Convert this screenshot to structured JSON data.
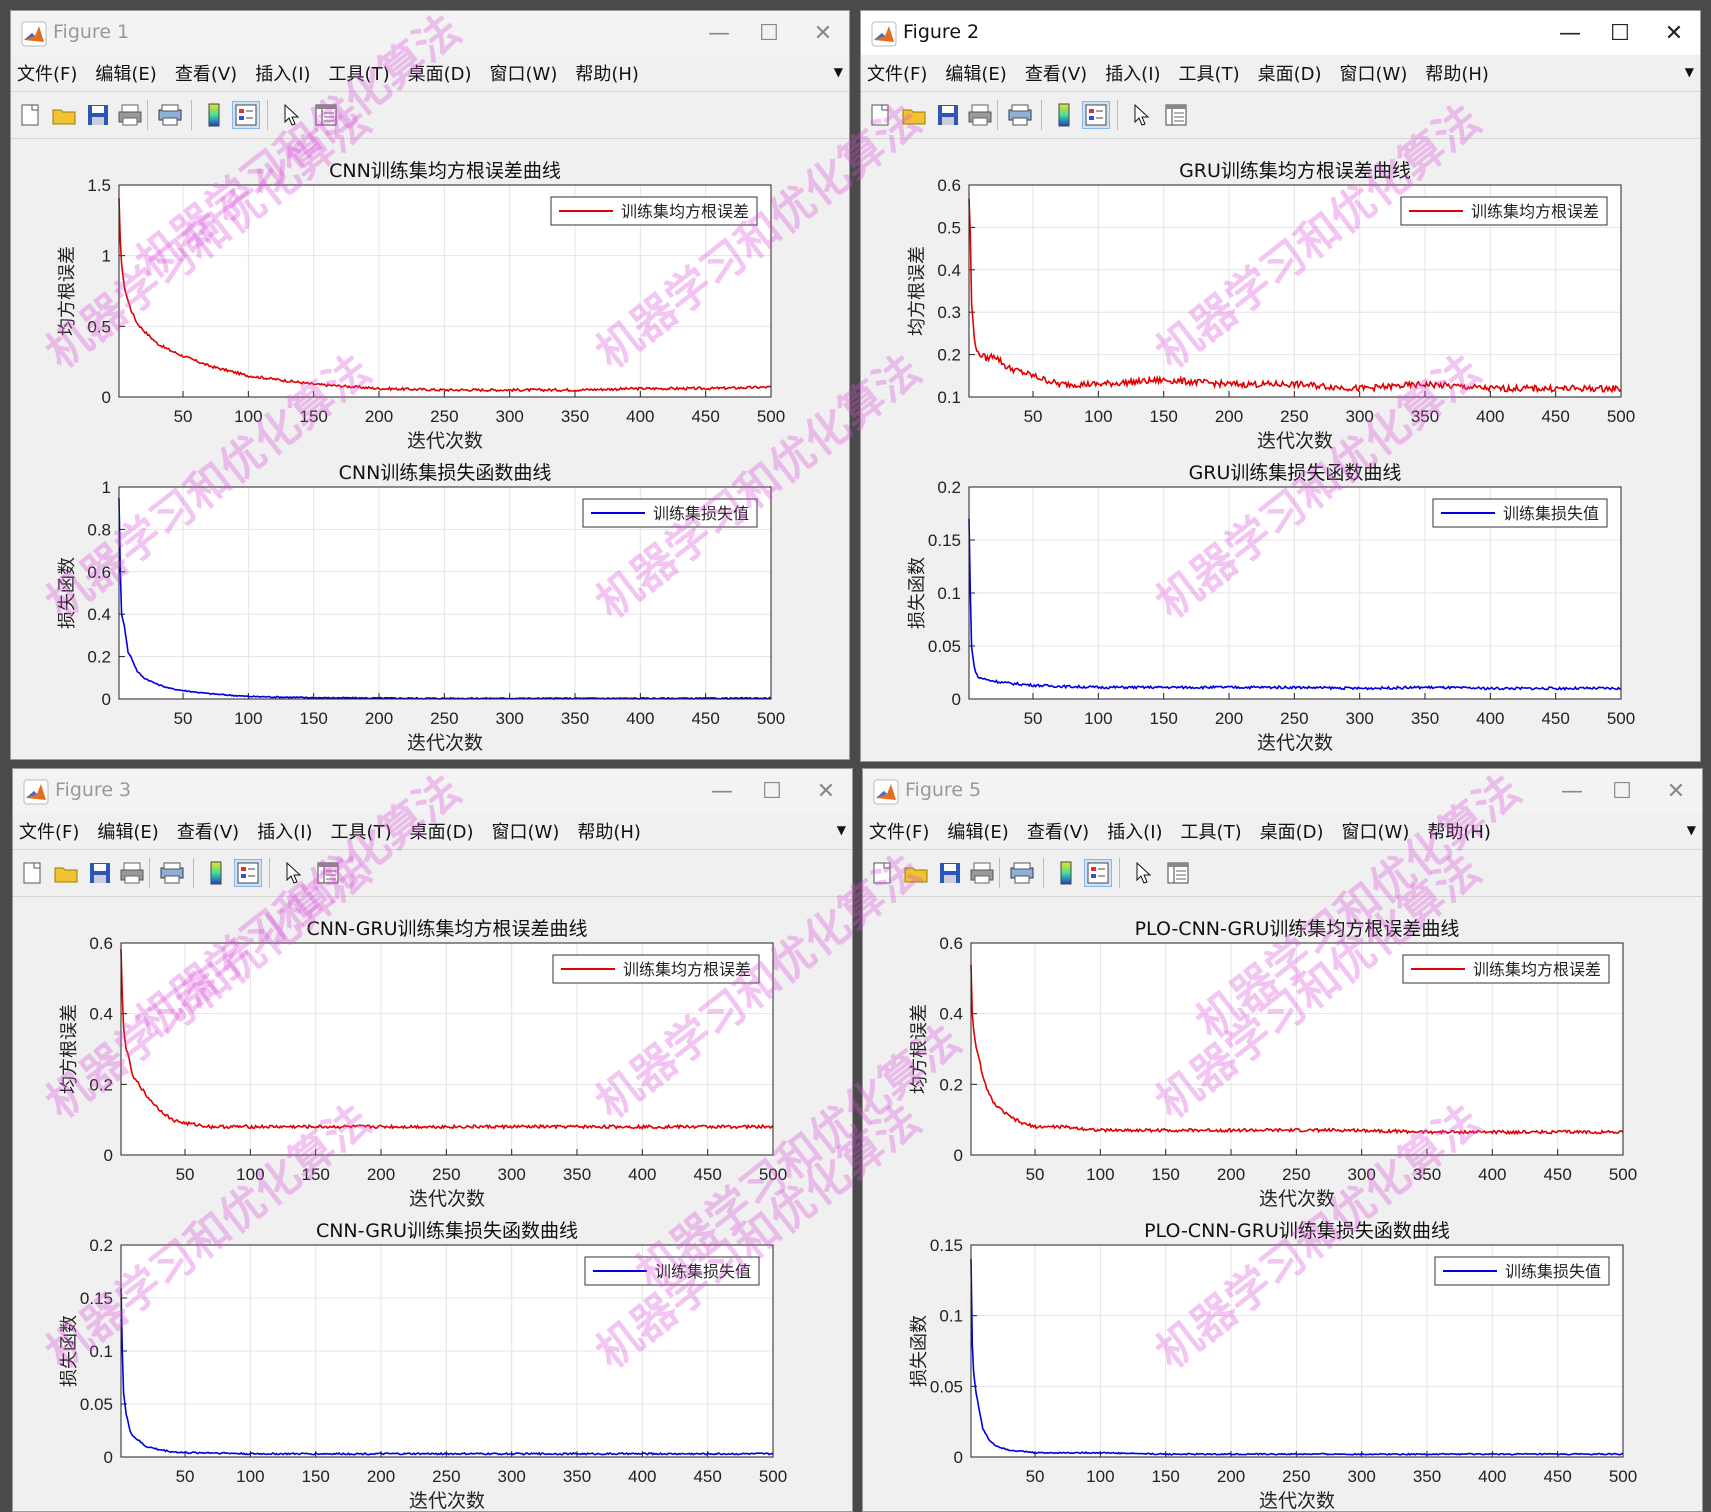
{
  "menu": [
    "文件(F)",
    "编辑(E)",
    "查看(V)",
    "插入(I)",
    "工具(T)",
    "桌面(D)",
    "窗口(W)",
    "帮助(H)"
  ],
  "toolbar_icons": [
    "new-figure-icon",
    "open-file-icon",
    "save-icon",
    "print-icon",
    "print-preview-icon",
    "colorbar-icon",
    "legend-icon",
    "pointer-icon",
    "property-inspector-icon"
  ],
  "windows": [
    {
      "title": "Figure 1",
      "active": false,
      "plots": [
        {
          "title": "CNN训练集均方根误差曲线",
          "xlabel": "迭代次数",
          "ylabel": "均方根误差",
          "legend": "训练集均方根误差",
          "color": "#e00000",
          "xlim": [
            1,
            500
          ],
          "ylim": [
            0,
            1.5
          ],
          "xticks": [
            "50",
            "100",
            "150",
            "200",
            "250",
            "300",
            "350",
            "400",
            "450",
            "500"
          ],
          "yticks": [
            "0",
            "0.5",
            "1",
            "1.5"
          ]
        },
        {
          "title": "CNN训练集损失函数曲线",
          "xlabel": "迭代次数",
          "ylabel": "损失函数",
          "legend": "训练集损失值",
          "color": "#0000e0",
          "xlim": [
            1,
            500
          ],
          "ylim": [
            0,
            1
          ],
          "xticks": [
            "50",
            "100",
            "150",
            "200",
            "250",
            "300",
            "350",
            "400",
            "450",
            "500"
          ],
          "yticks": [
            "0",
            "0.2",
            "0.4",
            "0.6",
            "0.8",
            "1"
          ]
        }
      ]
    },
    {
      "title": "Figure 2",
      "active": true,
      "plots": [
        {
          "title": "GRU训练集均方根误差曲线",
          "xlabel": "迭代次数",
          "ylabel": "均方根误差",
          "legend": "训练集均方根误差",
          "color": "#e00000",
          "xlim": [
            1,
            500
          ],
          "ylim": [
            0.1,
            0.6
          ],
          "xticks": [
            "50",
            "100",
            "150",
            "200",
            "250",
            "300",
            "350",
            "400",
            "450",
            "500"
          ],
          "yticks": [
            "0.1",
            "0.2",
            "0.3",
            "0.4",
            "0.5",
            "0.6"
          ]
        },
        {
          "title": "GRU训练集损失函数曲线",
          "xlabel": "迭代次数",
          "ylabel": "损失函数",
          "legend": "训练集损失值",
          "color": "#0000e0",
          "xlim": [
            1,
            500
          ],
          "ylim": [
            0,
            0.2
          ],
          "xticks": [
            "50",
            "100",
            "150",
            "200",
            "250",
            "300",
            "350",
            "400",
            "450",
            "500"
          ],
          "yticks": [
            "0",
            "0.05",
            "0.1",
            "0.15",
            "0.2"
          ]
        }
      ]
    },
    {
      "title": "Figure 3",
      "active": false,
      "plots": [
        {
          "title": "CNN-GRU训练集均方根误差曲线",
          "xlabel": "迭代次数",
          "ylabel": "均方根误差",
          "legend": "训练集均方根误差",
          "color": "#e00000",
          "xlim": [
            1,
            500
          ],
          "ylim": [
            0,
            0.6
          ],
          "xticks": [
            "50",
            "100",
            "150",
            "200",
            "250",
            "300",
            "350",
            "400",
            "450",
            "500"
          ],
          "yticks": [
            "0",
            "0.2",
            "0.4",
            "0.6"
          ]
        },
        {
          "title": "CNN-GRU训练集损失函数曲线",
          "xlabel": "迭代次数",
          "ylabel": "损失函数",
          "legend": "训练集损失值",
          "color": "#0000e0",
          "xlim": [
            1,
            500
          ],
          "ylim": [
            0,
            0.2
          ],
          "xticks": [
            "50",
            "100",
            "150",
            "200",
            "250",
            "300",
            "350",
            "400",
            "450",
            "500"
          ],
          "yticks": [
            "0",
            "0.05",
            "0.1",
            "0.15",
            "0.2"
          ]
        }
      ]
    },
    {
      "title": "Figure 5",
      "active": false,
      "plots": [
        {
          "title": "PLO-CNN-GRU训练集均方根误差曲线",
          "xlabel": "迭代次数",
          "ylabel": "均方根误差",
          "legend": "训练集均方根误差",
          "color": "#e00000",
          "xlim": [
            1,
            500
          ],
          "ylim": [
            0,
            0.6
          ],
          "xticks": [
            "50",
            "100",
            "150",
            "200",
            "250",
            "300",
            "350",
            "400",
            "450",
            "500"
          ],
          "yticks": [
            "0",
            "0.2",
            "0.4",
            "0.6"
          ]
        },
        {
          "title": "PLO-CNN-GRU训练集损失函数曲线",
          "xlabel": "迭代次数",
          "ylabel": "损失函数",
          "legend": "训练集损失值",
          "color": "#0000e0",
          "xlim": [
            1,
            500
          ],
          "ylim": [
            0,
            0.15
          ],
          "xticks": [
            "50",
            "100",
            "150",
            "200",
            "250",
            "300",
            "350",
            "400",
            "450",
            "500"
          ],
          "yticks": [
            "0",
            "0.05",
            "0.1",
            "0.15"
          ]
        }
      ]
    }
  ],
  "chart_data": [
    {
      "type": "line",
      "title": "CNN训练集均方根误差曲线",
      "xlabel": "迭代次数",
      "ylabel": "均方根误差",
      "xlim": [
        1,
        500
      ],
      "ylim": [
        0,
        1.5
      ],
      "grid": true,
      "legend": "top-right",
      "series": [
        {
          "name": "训练集均方根误差",
          "x": [
            1,
            2,
            3,
            5,
            8,
            10,
            15,
            20,
            30,
            40,
            50,
            70,
            100,
            150,
            200,
            250,
            300,
            350,
            400,
            450,
            500
          ],
          "y": [
            1.4,
            1.1,
            0.95,
            0.78,
            0.68,
            0.62,
            0.52,
            0.47,
            0.38,
            0.33,
            0.29,
            0.22,
            0.15,
            0.09,
            0.06,
            0.05,
            0.05,
            0.05,
            0.06,
            0.06,
            0.07
          ]
        }
      ]
    },
    {
      "type": "line",
      "title": "CNN训练集损失函数曲线",
      "xlabel": "迭代次数",
      "ylabel": "损失函数",
      "xlim": [
        1,
        500
      ],
      "ylim": [
        0,
        1
      ],
      "grid": true,
      "legend": "top-right",
      "series": [
        {
          "name": "训练集损失值",
          "x": [
            1,
            2,
            3,
            5,
            8,
            10,
            15,
            20,
            30,
            40,
            50,
            70,
            100,
            150,
            200,
            250,
            300,
            350,
            400,
            450,
            500
          ],
          "y": [
            0.95,
            0.6,
            0.4,
            0.35,
            0.22,
            0.2,
            0.13,
            0.1,
            0.07,
            0.05,
            0.04,
            0.025,
            0.012,
            0.006,
            0.004,
            0.003,
            0.003,
            0.003,
            0.003,
            0.003,
            0.004
          ]
        }
      ]
    },
    {
      "type": "line",
      "title": "GRU训练集均方根误差曲线",
      "xlabel": "迭代次数",
      "ylabel": "均方根误差",
      "xlim": [
        1,
        500
      ],
      "ylim": [
        0.1,
        0.6
      ],
      "grid": true,
      "legend": "top-right",
      "series": [
        {
          "name": "训练集均方根误差",
          "x": [
            1,
            2,
            3,
            5,
            8,
            10,
            15,
            20,
            30,
            40,
            50,
            70,
            100,
            150,
            200,
            250,
            300,
            350,
            400,
            450,
            500
          ],
          "y": [
            0.57,
            0.48,
            0.32,
            0.24,
            0.2,
            0.2,
            0.19,
            0.2,
            0.17,
            0.16,
            0.15,
            0.13,
            0.13,
            0.14,
            0.13,
            0.13,
            0.12,
            0.13,
            0.12,
            0.12,
            0.12
          ]
        }
      ]
    },
    {
      "type": "line",
      "title": "GRU训练集损失函数曲线",
      "xlabel": "迭代次数",
      "ylabel": "损失函数",
      "xlim": [
        1,
        500
      ],
      "ylim": [
        0,
        0.2
      ],
      "grid": true,
      "legend": "top-right",
      "series": [
        {
          "name": "训练集损失值",
          "x": [
            1,
            2,
            3,
            5,
            8,
            10,
            15,
            20,
            30,
            40,
            50,
            70,
            100,
            150,
            200,
            250,
            300,
            350,
            400,
            450,
            500
          ],
          "y": [
            0.17,
            0.1,
            0.05,
            0.03,
            0.02,
            0.02,
            0.018,
            0.017,
            0.015,
            0.014,
            0.013,
            0.012,
            0.011,
            0.011,
            0.011,
            0.011,
            0.01,
            0.011,
            0.01,
            0.01,
            0.01
          ]
        }
      ]
    },
    {
      "type": "line",
      "title": "CNN-GRU训练集均方根误差曲线",
      "xlabel": "迭代次数",
      "ylabel": "均方根误差",
      "xlim": [
        1,
        500
      ],
      "ylim": [
        0,
        0.6
      ],
      "grid": true,
      "legend": "top-right",
      "series": [
        {
          "name": "训练集均方根误差",
          "x": [
            1,
            2,
            3,
            5,
            8,
            10,
            15,
            20,
            30,
            40,
            50,
            70,
            100,
            150,
            200,
            250,
            300,
            350,
            400,
            450,
            500
          ],
          "y": [
            0.58,
            0.45,
            0.36,
            0.3,
            0.26,
            0.22,
            0.2,
            0.17,
            0.13,
            0.1,
            0.09,
            0.08,
            0.08,
            0.08,
            0.08,
            0.08,
            0.08,
            0.08,
            0.08,
            0.08,
            0.08
          ]
        }
      ]
    },
    {
      "type": "line",
      "title": "CNN-GRU训练集损失函数曲线",
      "xlabel": "迭代次数",
      "ylabel": "损失函数",
      "xlim": [
        1,
        500
      ],
      "ylim": [
        0,
        0.2
      ],
      "grid": true,
      "legend": "top-right",
      "series": [
        {
          "name": "训练集损失值",
          "x": [
            1,
            2,
            3,
            5,
            8,
            10,
            15,
            20,
            30,
            40,
            50,
            70,
            100,
            150,
            200,
            250,
            300,
            350,
            400,
            450,
            500
          ],
          "y": [
            0.16,
            0.1,
            0.06,
            0.04,
            0.025,
            0.02,
            0.015,
            0.01,
            0.007,
            0.005,
            0.004,
            0.004,
            0.003,
            0.003,
            0.003,
            0.003,
            0.003,
            0.003,
            0.003,
            0.003,
            0.003
          ]
        }
      ]
    },
    {
      "type": "line",
      "title": "PLO-CNN-GRU训练集均方根误差曲线",
      "xlabel": "迭代次数",
      "ylabel": "均方根误差",
      "xlim": [
        1,
        500
      ],
      "ylim": [
        0,
        0.6
      ],
      "grid": true,
      "legend": "top-right",
      "series": [
        {
          "name": "训练集均方根误差",
          "x": [
            1,
            2,
            3,
            5,
            8,
            10,
            15,
            20,
            30,
            40,
            50,
            70,
            100,
            150,
            200,
            250,
            300,
            350,
            400,
            450,
            500
          ],
          "y": [
            0.54,
            0.4,
            0.36,
            0.3,
            0.26,
            0.22,
            0.17,
            0.14,
            0.11,
            0.09,
            0.08,
            0.08,
            0.07,
            0.07,
            0.07,
            0.07,
            0.07,
            0.065,
            0.065,
            0.065,
            0.065
          ]
        }
      ]
    },
    {
      "type": "line",
      "title": "PLO-CNN-GRU训练集损失函数曲线",
      "xlabel": "迭代次数",
      "ylabel": "损失函数",
      "xlim": [
        1,
        500
      ],
      "ylim": [
        0,
        0.15
      ],
      "grid": true,
      "legend": "top-right",
      "series": [
        {
          "name": "训练集损失值",
          "x": [
            1,
            2,
            3,
            5,
            8,
            10,
            15,
            20,
            30,
            40,
            50,
            70,
            100,
            150,
            200,
            250,
            300,
            350,
            400,
            450,
            500
          ],
          "y": [
            0.14,
            0.08,
            0.06,
            0.045,
            0.03,
            0.02,
            0.012,
            0.008,
            0.005,
            0.004,
            0.003,
            0.003,
            0.003,
            0.002,
            0.002,
            0.002,
            0.002,
            0.002,
            0.002,
            0.002,
            0.002
          ]
        }
      ]
    }
  ],
  "watermark": "机器学习和优化算法"
}
